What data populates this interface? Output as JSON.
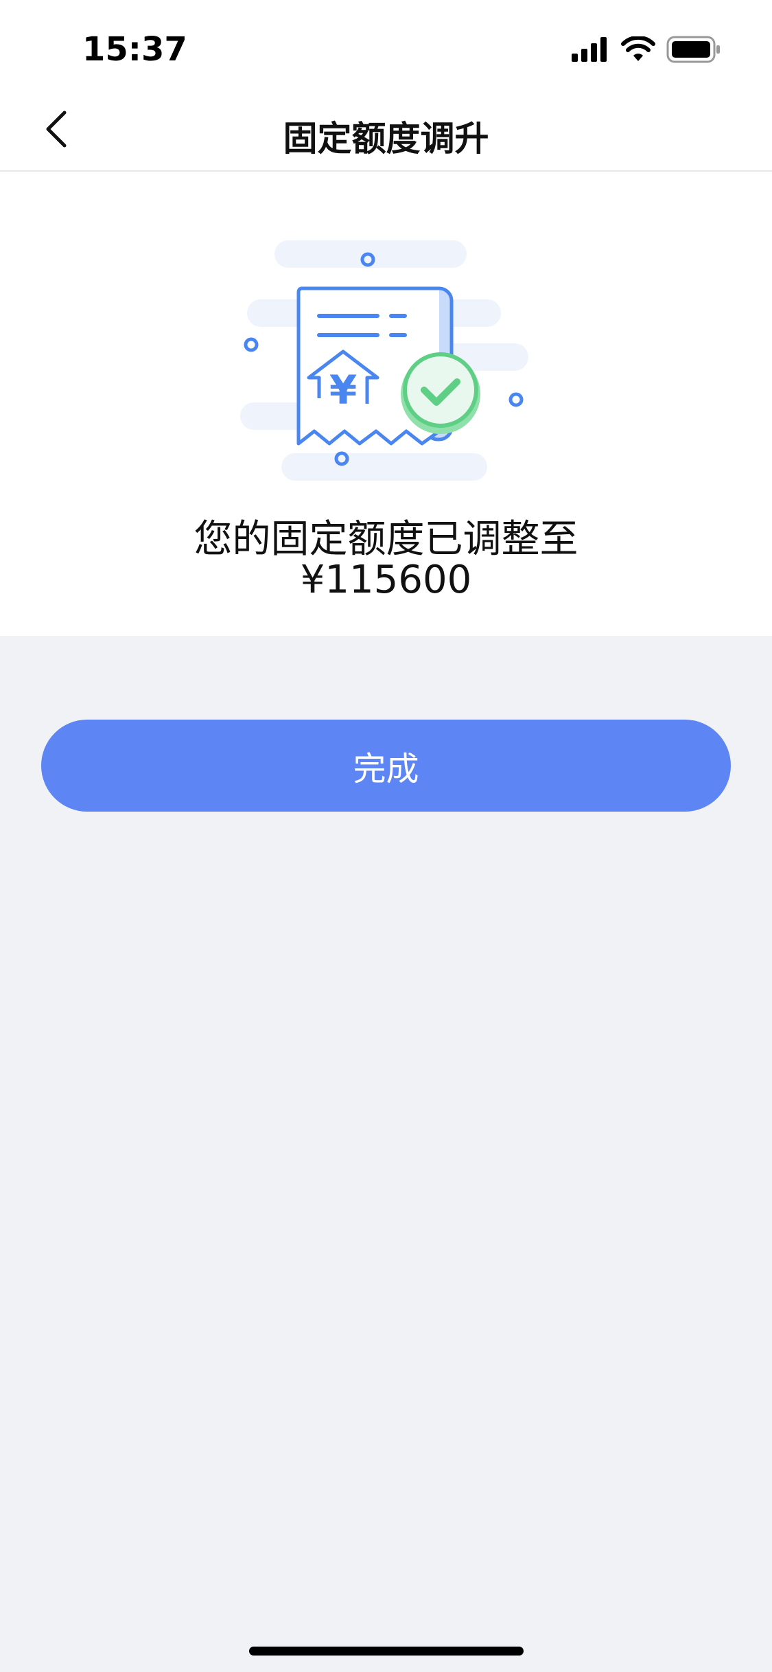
{
  "status_bar": {
    "time": "15:37",
    "icons": [
      "cellular-signal-icon",
      "wifi-icon",
      "battery-icon"
    ]
  },
  "nav": {
    "back_icon": "chevron-left-icon",
    "title": "固定额度调升"
  },
  "result": {
    "illustration": "receipt-success-illustration",
    "message_line1": "您的固定额度已调整至",
    "amount": "¥115600"
  },
  "actions": {
    "done_label": "完成"
  },
  "colors": {
    "accent": "#5d85f3",
    "success": "#5fcf86",
    "illustration_blue": "#4a86f0",
    "illustration_light": "#eef3fc",
    "page_background": "#f0f2f6"
  }
}
